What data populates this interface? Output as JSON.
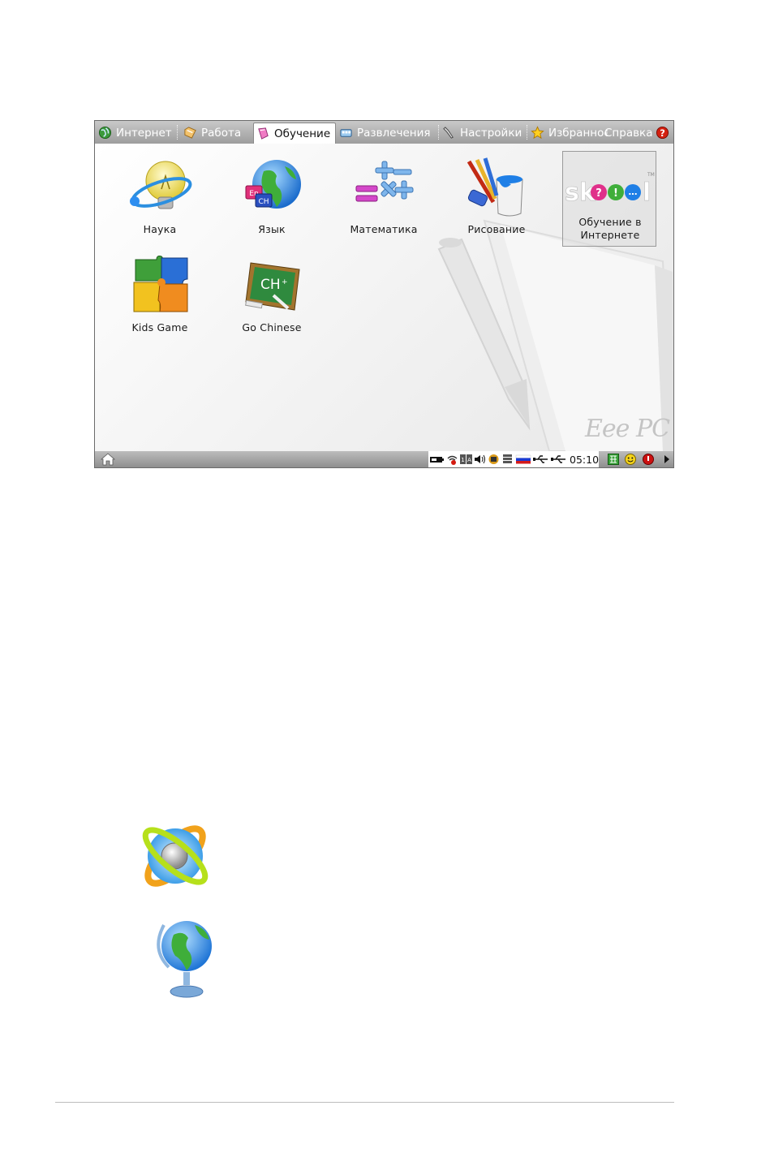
{
  "tabs": [
    {
      "label": "Интернет",
      "icon": "globe-icon"
    },
    {
      "label": "Работа",
      "icon": "folder-icon"
    },
    {
      "label": "Обучение",
      "icon": "book-icon",
      "active": true
    },
    {
      "label": "Развлечения",
      "icon": "bus-icon"
    },
    {
      "label": "Настройки",
      "icon": "wrench-icon"
    },
    {
      "label": "Избранное",
      "icon": "star-icon"
    },
    {
      "label": "Справка",
      "icon": "question-icon"
    }
  ],
  "apps": [
    {
      "label": "Наука",
      "icon": "lightbulb-atom-icon"
    },
    {
      "label": "Язык",
      "icon": "globe-language-icon"
    },
    {
      "label": "Математика",
      "icon": "math-symbols-icon"
    },
    {
      "label": "Рисование",
      "icon": "paint-brushes-icon"
    },
    {
      "label": "Обучение в Интернете",
      "icon": "skoool-logo",
      "selected": true
    },
    {
      "label": "Kids Game",
      "icon": "puzzle-icon"
    },
    {
      "label": "Go Chinese",
      "icon": "chalkboard-icon"
    }
  ],
  "skoool_logo_text": "skoool",
  "brand_watermark": "Eee PC",
  "taskbar": {
    "home_icon": "home-icon",
    "clock": "05:10",
    "tray_icons": [
      "battery-icon",
      "wireless-off-icon",
      "keyboard-layout-icon",
      "volume-icon",
      "network-icon",
      "storage-icon",
      "russian-flag-icon",
      "usb-icon",
      "usb-icon"
    ],
    "right_icons": [
      "keyboard-grid-icon",
      "smiley-icon",
      "shutdown-icon",
      "arrow-right-icon"
    ]
  },
  "colors": {
    "tab_bar": "#a9a9a9",
    "taskbar": "#a0a0a0",
    "shutdown": "#cc1111"
  }
}
